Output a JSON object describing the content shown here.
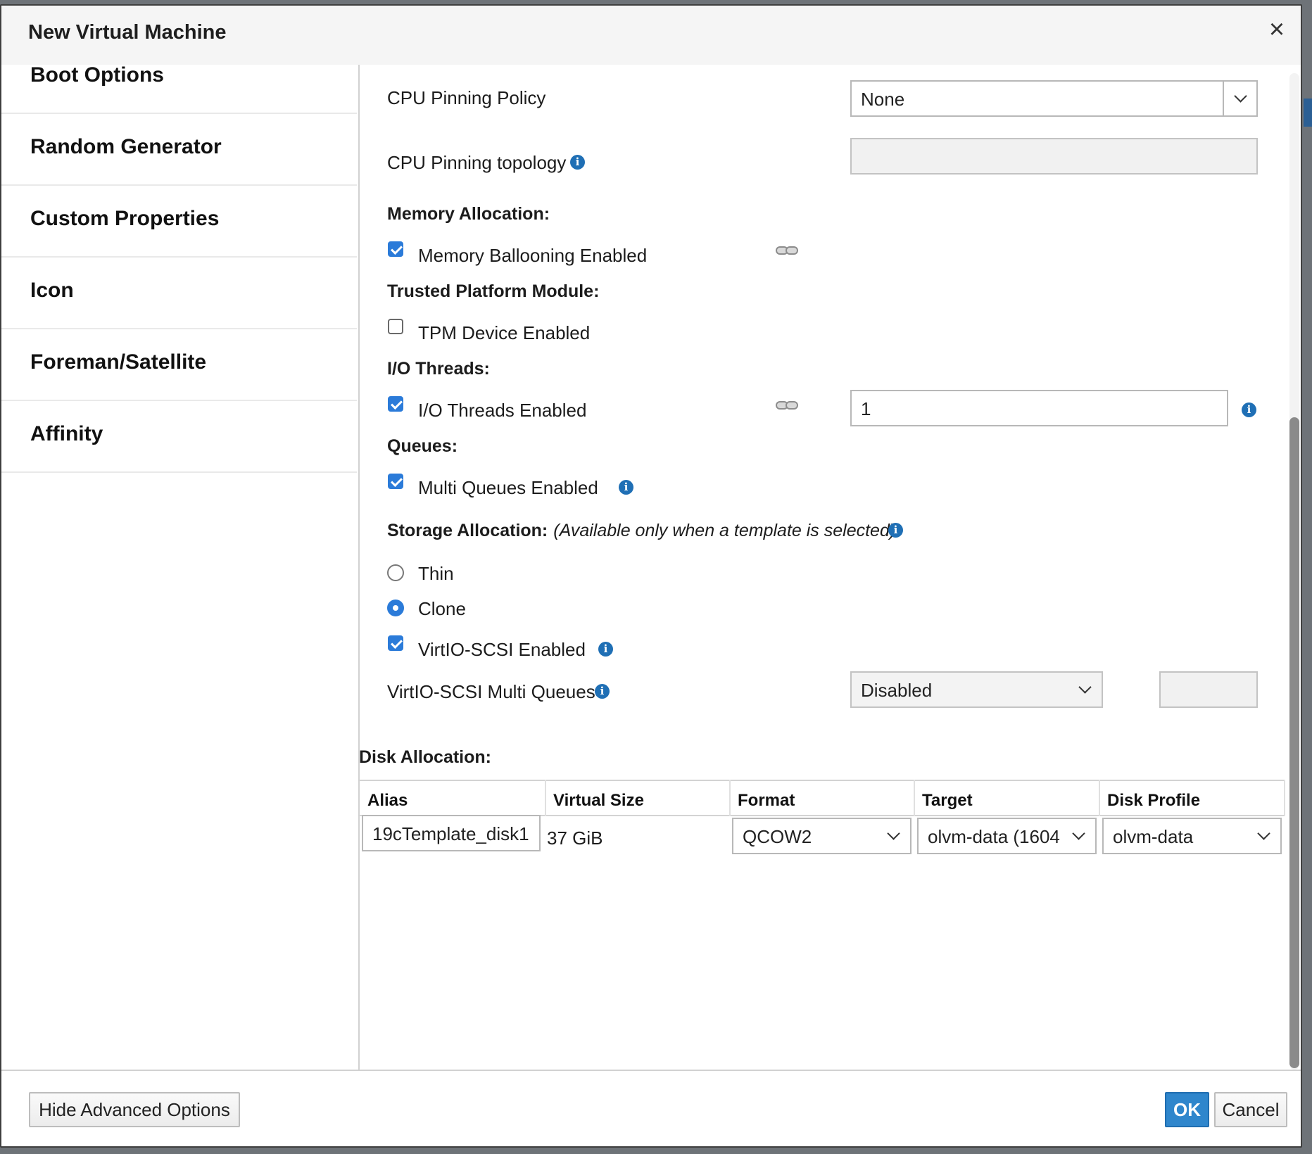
{
  "dialog": {
    "title": "New Virtual Machine",
    "close_icon": "×"
  },
  "sidebar": {
    "items": [
      {
        "label": "Boot Options"
      },
      {
        "label": "Random Generator"
      },
      {
        "label": "Custom Properties"
      },
      {
        "label": "Icon"
      },
      {
        "label": "Foreman/Satellite"
      },
      {
        "label": "Affinity"
      }
    ]
  },
  "cpu": {
    "pinning_policy_label": "CPU Pinning Policy",
    "pinning_policy_value": "None",
    "pinning_topology_label": "CPU Pinning topology",
    "pinning_topology_value": ""
  },
  "memory": {
    "section_label": "Memory Allocation:",
    "ballooning_label": "Memory Ballooning Enabled",
    "ballooning_checked": true
  },
  "tpm": {
    "section_label": "Trusted Platform Module:",
    "device_label": "TPM Device Enabled",
    "device_checked": false
  },
  "io_threads": {
    "section_label": "I/O Threads:",
    "enabled_label": "I/O Threads Enabled",
    "enabled_checked": true,
    "count_value": "1"
  },
  "queues": {
    "section_label": "Queues:",
    "multi_label": "Multi Queues Enabled",
    "multi_checked": true
  },
  "storage": {
    "section_label": "Storage Allocation:",
    "note": "(Available only when a template is selected)",
    "options": [
      {
        "label": "Thin",
        "selected": false
      },
      {
        "label": "Clone",
        "selected": true
      }
    ],
    "virtio_label": "VirtIO-SCSI Enabled",
    "virtio_checked": true,
    "multi_queues_label": "VirtIO-SCSI Multi Queues",
    "multi_queues_value": "Disabled",
    "multi_queues_count": ""
  },
  "disk": {
    "section_label": "Disk Allocation:",
    "columns": [
      "Alias",
      "Virtual Size",
      "Format",
      "Target",
      "Disk Profile"
    ],
    "rows": [
      {
        "alias": "19cTemplate_disk1",
        "virtual_size": "37 GiB",
        "format": "QCOW2",
        "target": "olvm-data (1604",
        "disk_profile": "olvm-data"
      }
    ]
  },
  "footer": {
    "toggle_label": "Hide Advanced Options",
    "ok_label": "OK",
    "cancel_label": "Cancel"
  },
  "icons": {
    "info": "info-icon",
    "link": "link-icon",
    "dropdown": "chevron-down-icon"
  },
  "colors": {
    "accent": "#2b7bd9",
    "info": "#1f6fb5",
    "primary_button": "#2f86cc"
  }
}
